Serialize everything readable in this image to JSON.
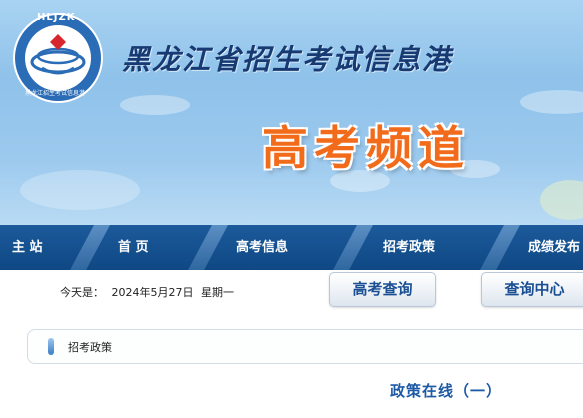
{
  "header": {
    "logo_text": "HLJZK",
    "logo_sub": "黑龙江招生考试信息港",
    "site_title": "黑龙江省招生考试信息港",
    "channel_title": "高考频道"
  },
  "nav": {
    "items": [
      {
        "label": "主 站"
      },
      {
        "label": "首 页"
      },
      {
        "label": "高考信息"
      },
      {
        "label": "招考政策"
      },
      {
        "label": "成绩发布"
      }
    ]
  },
  "toolbar": {
    "date_prefix": "今天是：",
    "date": "2024年5月27日",
    "weekday": "星期一",
    "gaokao_query_label": "高考查询",
    "query_center_label": "查询中心"
  },
  "breadcrumb": {
    "current": "招考政策"
  },
  "main": {
    "heading": "政策在线（一）"
  },
  "colors": {
    "nav_bg": "#0f4884",
    "accent_orange": "#f26b1b",
    "link_blue": "#1d5aa5"
  }
}
